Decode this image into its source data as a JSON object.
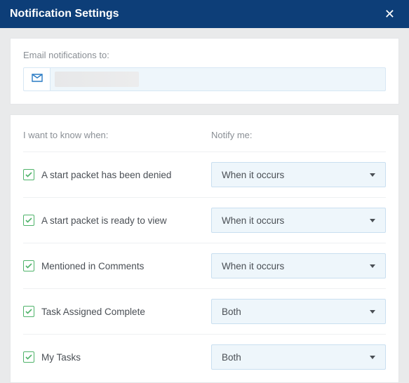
{
  "title": "Notification Settings",
  "email_section": {
    "label": "Email notifications to:",
    "value": ""
  },
  "columns": {
    "left": "I want to know when:",
    "right": "Notify me:"
  },
  "rows": [
    {
      "label": "A start packet has been denied",
      "checked": true,
      "notify": "When it occurs"
    },
    {
      "label": "A start packet is ready to view",
      "checked": true,
      "notify": "When it occurs"
    },
    {
      "label": "Mentioned in Comments",
      "checked": true,
      "notify": "When it occurs"
    },
    {
      "label": "Task Assigned Complete",
      "checked": true,
      "notify": "Both"
    },
    {
      "label": "My Tasks",
      "checked": true,
      "notify": "Both"
    }
  ]
}
